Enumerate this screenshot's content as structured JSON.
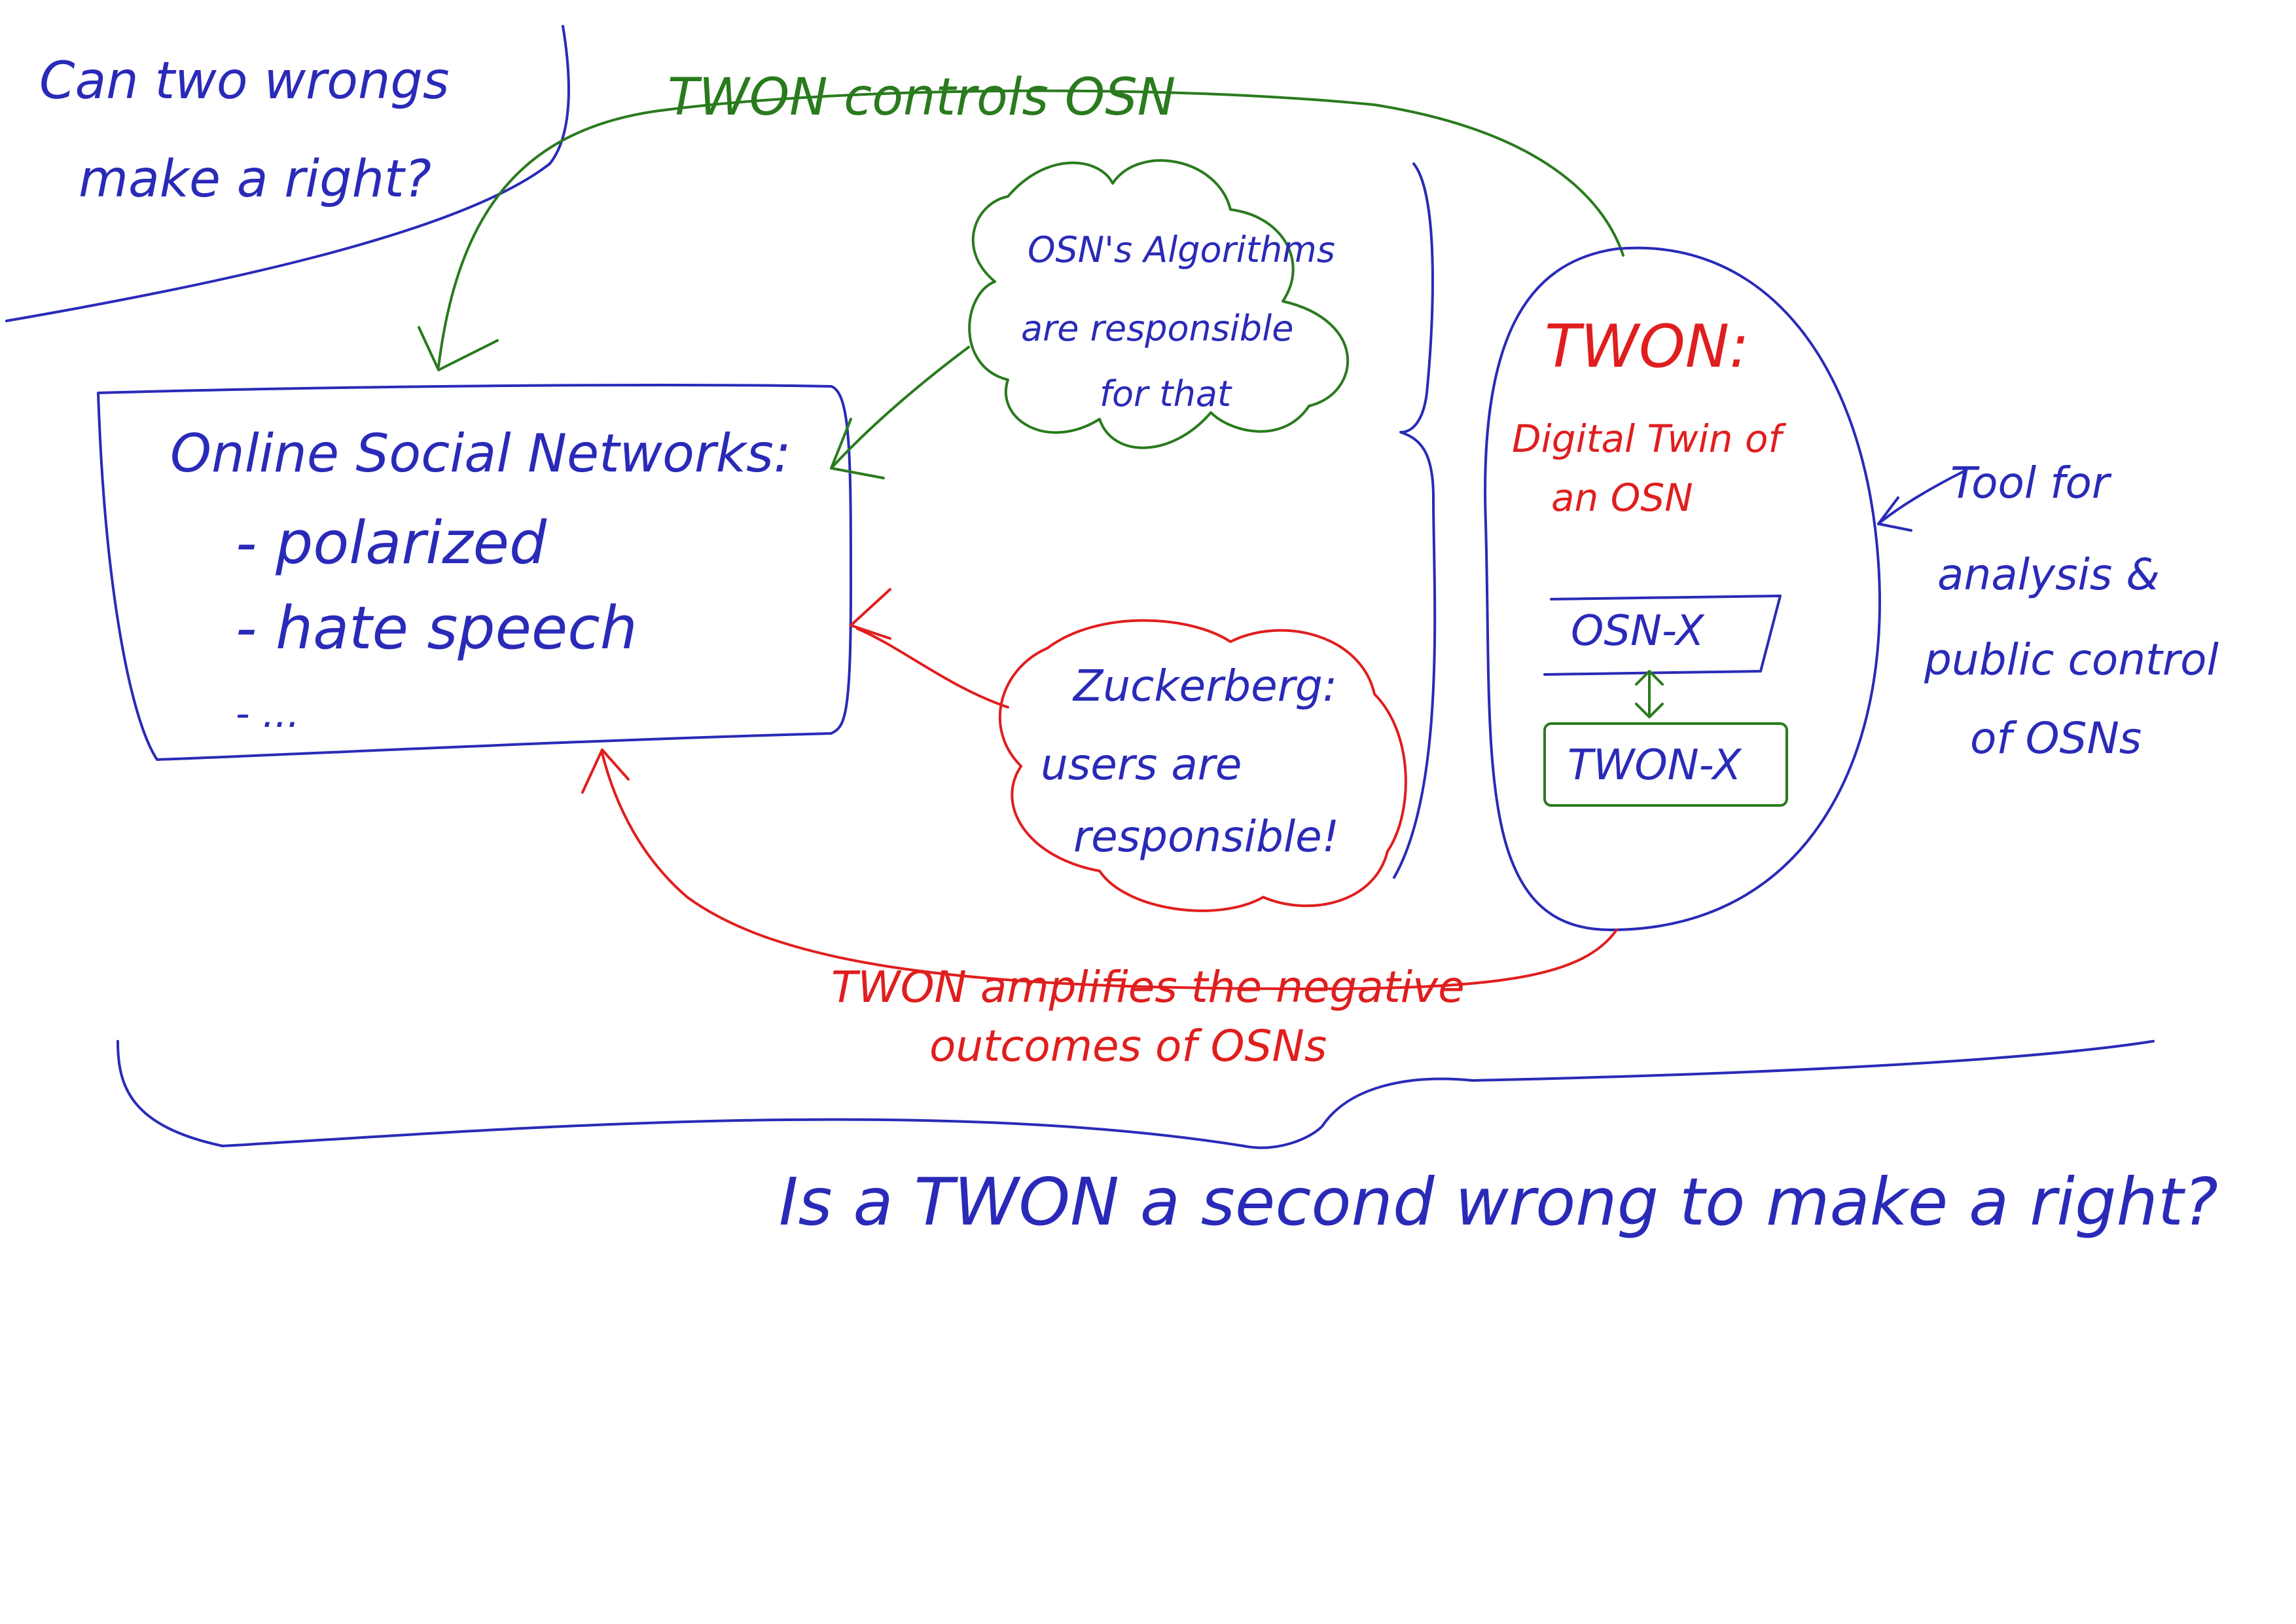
{
  "corner_question": {
    "line1": "Can two wrongs",
    "line2": "make a right?"
  },
  "top_arrow_label": "TWON controls OSN",
  "osn_box": {
    "title": "Online Social Networks:",
    "items": [
      "- polarized",
      "- hate speech",
      "- ..."
    ]
  },
  "cloud_algorithms": {
    "line1": "OSN's Algorithms",
    "line2": "are responsible",
    "line3": "for that"
  },
  "cloud_users": {
    "line1": "Zuckerberg:",
    "line2": "users are",
    "line3": "responsible!"
  },
  "twon_oval": {
    "title": "TWON:",
    "subtitle1": "Digital Twin of",
    "subtitle2": "an OSN",
    "box_osn": "OSN-X",
    "box_twon": "TWON-X"
  },
  "side_note": {
    "line1": "Tool for",
    "line2": "analysis &",
    "line3": "public control",
    "line4": "of OSNs"
  },
  "bottom_arrow_label": {
    "line1": "TWON amplifies the negative",
    "line2": "outcomes of OSNs"
  },
  "bottom_question": "Is a TWON a second wrong to make a right?",
  "colors": {
    "blue": "#2a2ab8",
    "green": "#2a7a1e",
    "red": "#e01e1e"
  }
}
